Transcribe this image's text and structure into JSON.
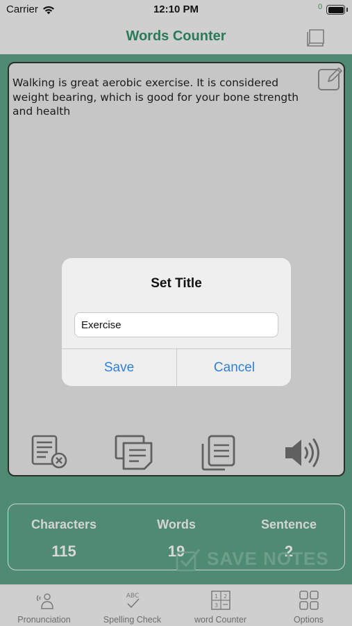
{
  "status_bar": {
    "carrier": "Carrier",
    "time": "12:10 PM"
  },
  "nav": {
    "title": "Words Counter",
    "notes_count": "0"
  },
  "editor": {
    "text": "Walking is great aerobic exercise. It is considered weight bearing, which is good for your bone strength and health"
  },
  "toolbar": {
    "icons": [
      "clear-text-icon",
      "copy-text-icon",
      "paste-icon",
      "speaker-icon"
    ]
  },
  "stats": {
    "characters_label": "Characters",
    "characters_value": "115",
    "words_label": "Words",
    "words_value": "19",
    "sentence_label": "Sentence",
    "sentence_value": "2"
  },
  "watermark": {
    "text": "SAVE NOTES"
  },
  "dialog": {
    "title": "Set Title",
    "input_value": "Exercise",
    "save_label": "Save",
    "cancel_label": "Cancel"
  },
  "tabs": [
    {
      "label": "Pronunciation",
      "icon": "pronunciation-icon"
    },
    {
      "label": "Spelling Check",
      "icon": "spelling-check-icon"
    },
    {
      "label": "word Counter",
      "icon": "word-counter-icon"
    },
    {
      "label": "Options",
      "icon": "options-grid-icon"
    }
  ],
  "colors": {
    "accent_green": "#2a7a5a",
    "panel_green": "#4f8b72",
    "link_blue": "#2f7fd6"
  }
}
